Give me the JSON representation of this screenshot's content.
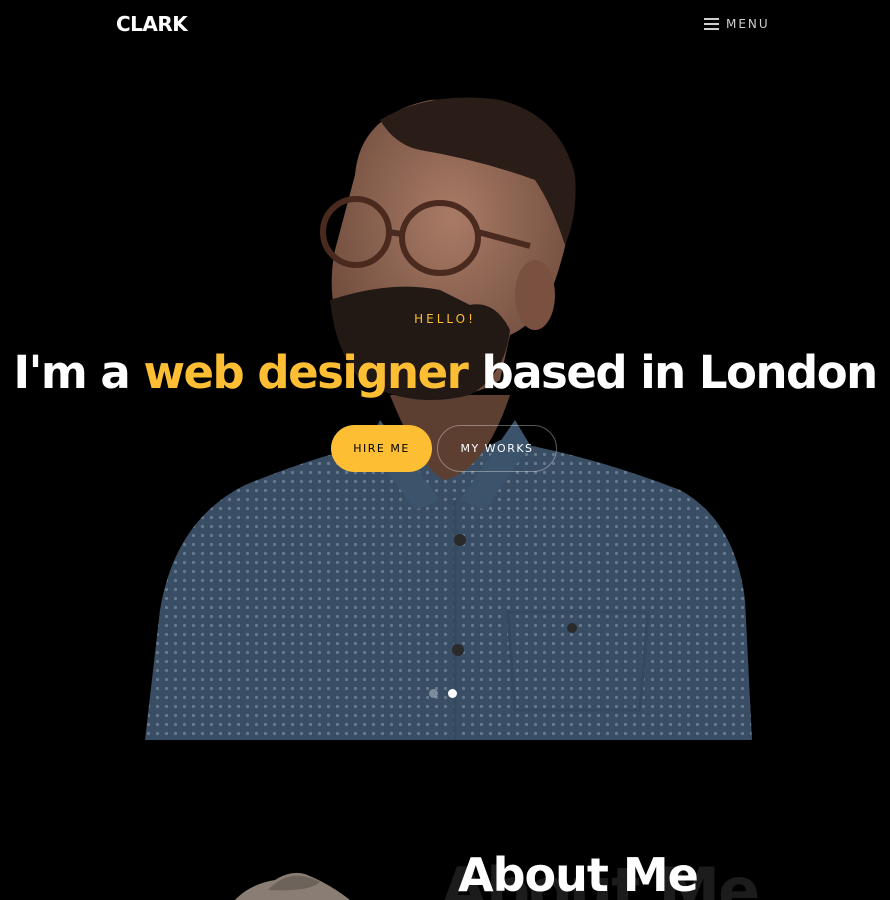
{
  "header": {
    "logo": "CLARK",
    "menu_label": "MENU"
  },
  "hero": {
    "greeting": "HELLO!",
    "headline_start": "I'm a ",
    "headline_accent": "web designer",
    "headline_end": " based in London",
    "hire_button": "HIRE ME",
    "works_button": "MY WORKS",
    "slides": {
      "count": 2,
      "active": 2
    }
  },
  "about": {
    "title": "About Me"
  },
  "colors": {
    "accent": "#fdbe34",
    "background": "#000000",
    "text": "#ffffff"
  },
  "icons": {
    "menu": "hamburger-icon"
  }
}
